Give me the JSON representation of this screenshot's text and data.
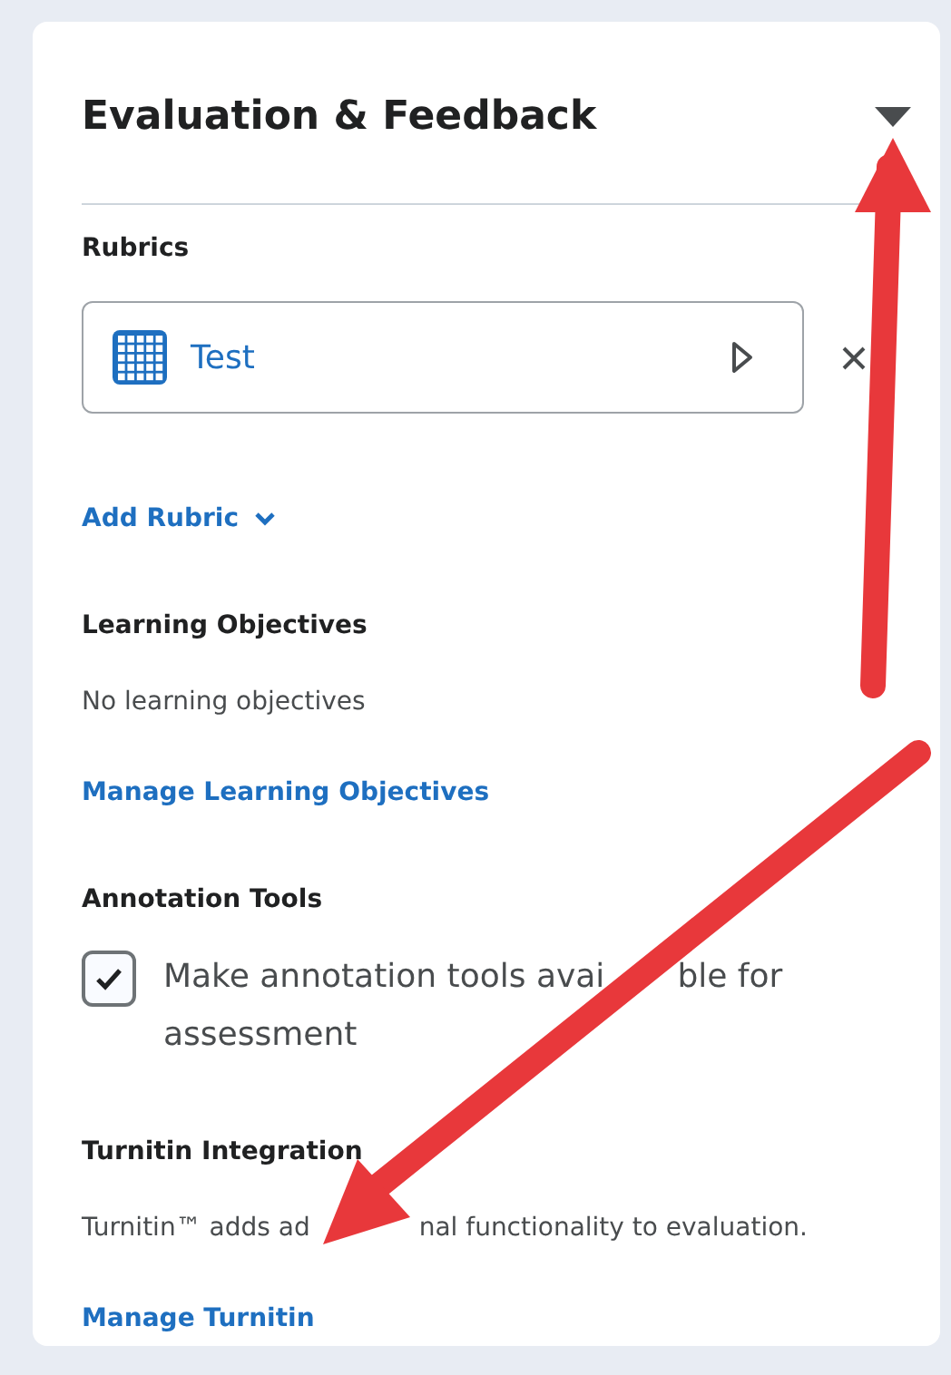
{
  "panel": {
    "title": "Evaluation & Feedback",
    "sections": [
      {
        "heading": "Rubrics",
        "items": [
          {
            "kind": "rubric",
            "name": "Test"
          },
          {
            "kind": "dropdown_link",
            "label": "Add Rubric"
          }
        ]
      },
      {
        "heading": "Learning Objectives",
        "items": [
          {
            "kind": "text",
            "text": "No learning objectives"
          },
          {
            "kind": "link",
            "label": "Manage Learning Objectives"
          }
        ]
      },
      {
        "heading": "Annotation Tools",
        "items": [
          {
            "kind": "checkbox",
            "label_lines": [
              [
                "Make annotation tools avai",
                "ble for"
              ],
              [
                "assessment"
              ]
            ],
            "checked": true
          }
        ]
      },
      {
        "heading": "Turnitin Integration",
        "items": [
          {
            "kind": "text",
            "text_parts": [
              "Turnitin™ adds ad",
              "nal functionality to evaluation."
            ]
          },
          {
            "kind": "link",
            "label": "Manage Turnitin"
          }
        ]
      }
    ]
  }
}
